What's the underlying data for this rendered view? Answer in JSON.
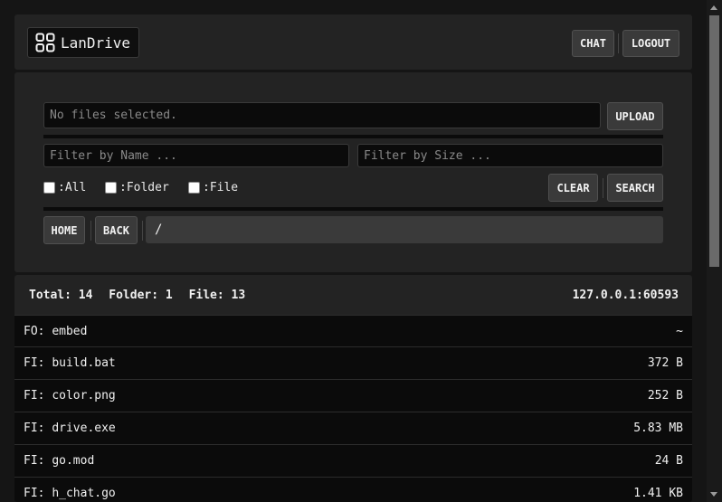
{
  "app": {
    "name": "LanDrive"
  },
  "header": {
    "chat_label": "CHAT",
    "logout_label": "LOGOUT"
  },
  "upload": {
    "status_text": "No files selected.",
    "button_label": "UPLOAD"
  },
  "filters": {
    "name_placeholder": "Filter by Name ...",
    "size_placeholder": "Filter by Size ...",
    "checks": [
      ":All",
      ":Folder",
      ":File"
    ],
    "clear_label": "CLEAR",
    "search_label": "SEARCH"
  },
  "nav": {
    "home_label": "HOME",
    "back_label": "BACK",
    "path": "/"
  },
  "stats": {
    "total": "Total: 14",
    "folder": "Folder: 1",
    "file": "File: 13",
    "address": "127.0.0.1:60593"
  },
  "files": [
    {
      "prefix": "FO:",
      "name": "embed",
      "size": "~"
    },
    {
      "prefix": "FI:",
      "name": "build.bat",
      "size": "372 B"
    },
    {
      "prefix": "FI:",
      "name": "color.png",
      "size": "252 B"
    },
    {
      "prefix": "FI:",
      "name": "drive.exe",
      "size": "5.83 MB"
    },
    {
      "prefix": "FI:",
      "name": "go.mod",
      "size": "24 B"
    },
    {
      "prefix": "FI:",
      "name": "h_chat.go",
      "size": "1.41 KB"
    }
  ],
  "colors": {
    "background": "#151515",
    "panel": "#232323",
    "field": "#0b0b0b",
    "button": "#3a3a3a"
  }
}
